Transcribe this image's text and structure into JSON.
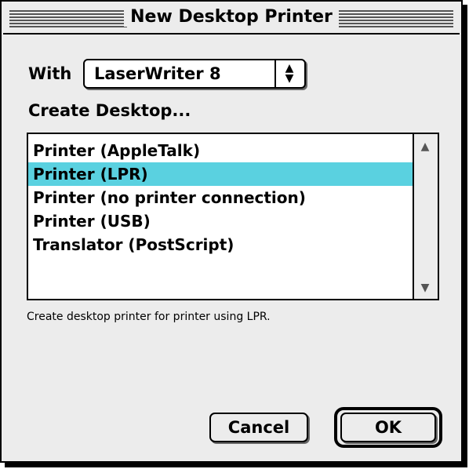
{
  "window": {
    "title": "New Desktop Printer"
  },
  "with": {
    "label": "With",
    "driver": "LaserWriter 8"
  },
  "create": {
    "label": "Create Desktop..."
  },
  "list": {
    "items": [
      {
        "label": "Printer (AppleTalk)",
        "selected": false
      },
      {
        "label": "Printer (LPR)",
        "selected": true
      },
      {
        "label": "Printer (no printer connection)",
        "selected": false
      },
      {
        "label": "Printer (USB)",
        "selected": false
      },
      {
        "label": "Translator (PostScript)",
        "selected": false
      }
    ],
    "selection_color": "#5ad1e0"
  },
  "description": "Create desktop printer for printer using LPR.",
  "buttons": {
    "cancel": "Cancel",
    "ok": "OK"
  }
}
